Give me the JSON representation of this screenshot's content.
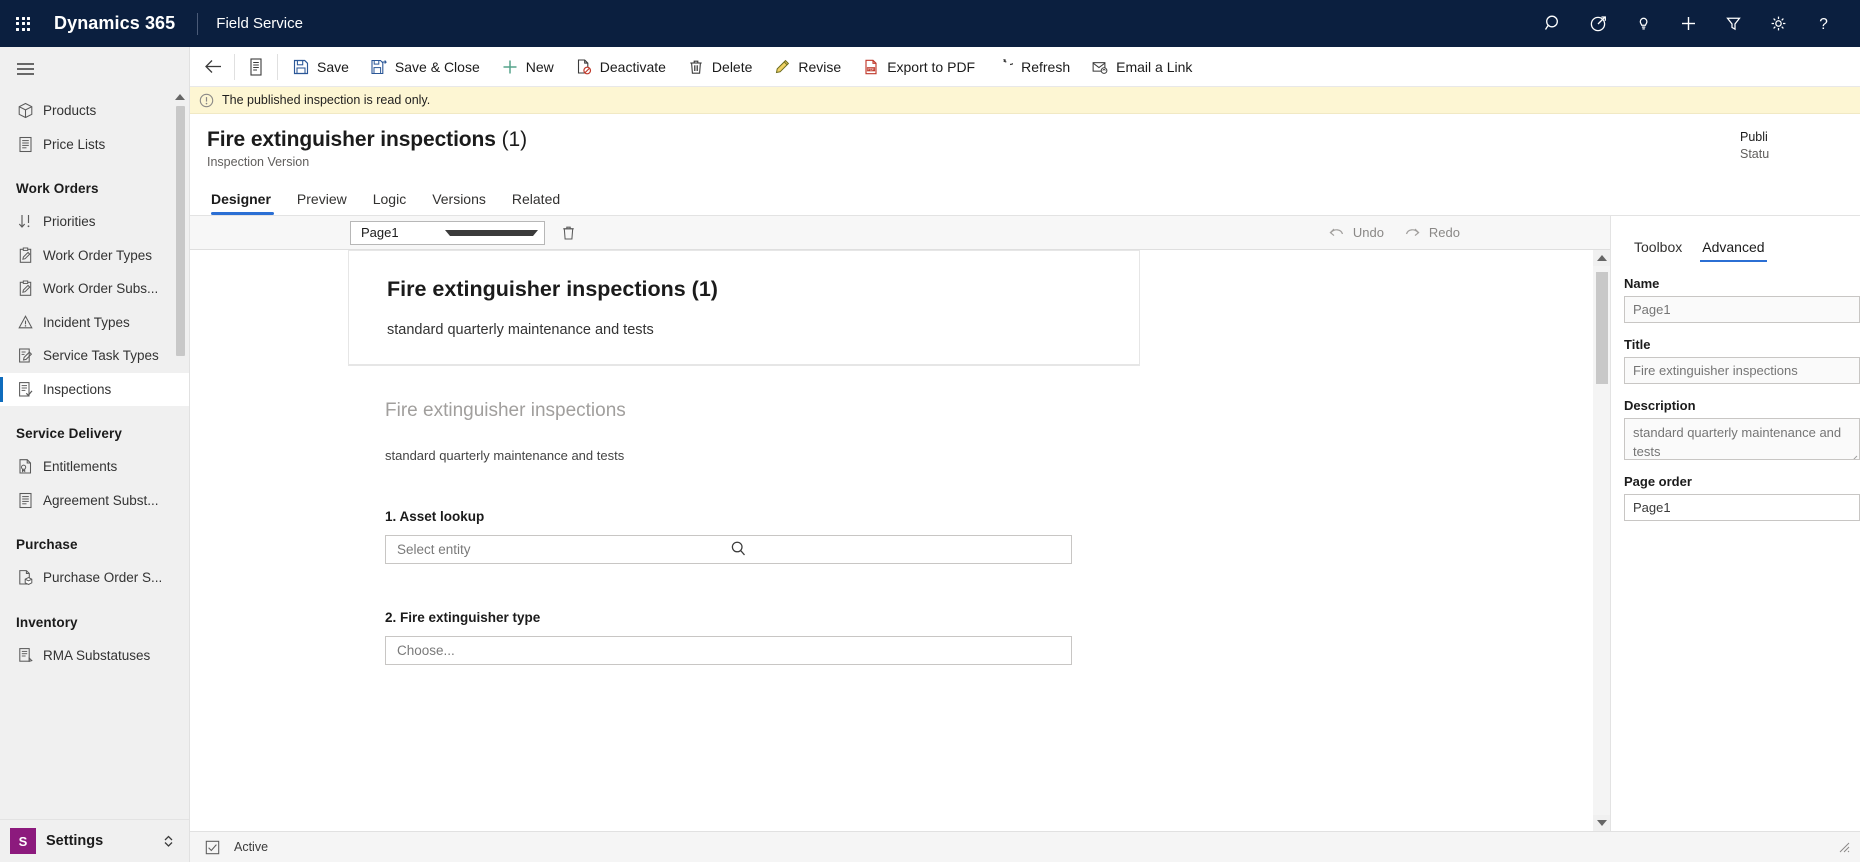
{
  "topnav": {
    "waffle_icon": "app-launcher-icon",
    "brand": "Dynamics 365",
    "app_name": "Field Service",
    "icons": [
      {
        "name": "search-icon",
        "label": "Search"
      },
      {
        "name": "assistant-icon",
        "label": "Assistant"
      },
      {
        "name": "lightbulb-icon",
        "label": "Insights"
      },
      {
        "name": "plus-icon",
        "label": "Quick create"
      },
      {
        "name": "filter-icon",
        "label": "Filter"
      },
      {
        "name": "gear-icon",
        "label": "Settings"
      },
      {
        "name": "help-icon",
        "label": "Help"
      }
    ]
  },
  "sidebar": {
    "hamburger_icon": "hamburger-icon",
    "entries": [
      {
        "type": "item",
        "label": "Products",
        "icon": "box-icon",
        "selected": false
      },
      {
        "type": "item",
        "label": "Price Lists",
        "icon": "list-doc-icon",
        "selected": false
      },
      {
        "type": "group",
        "label": "Work Orders"
      },
      {
        "type": "item",
        "label": "Priorities",
        "icon": "sort-arrows-icon",
        "selected": false
      },
      {
        "type": "item",
        "label": "Work Order Types",
        "icon": "clipboard-pen-icon",
        "selected": false
      },
      {
        "type": "item",
        "label": "Work Order Subs...",
        "icon": "clipboard-pen-icon",
        "selected": false
      },
      {
        "type": "item",
        "label": "Incident Types",
        "icon": "warning-triangle-icon",
        "selected": false
      },
      {
        "type": "item",
        "label": "Service Task Types",
        "icon": "task-pen-icon",
        "selected": false
      },
      {
        "type": "item",
        "label": "Inspections",
        "icon": "checklist-icon",
        "selected": true
      },
      {
        "type": "group",
        "label": "Service Delivery"
      },
      {
        "type": "item",
        "label": "Entitlements",
        "icon": "seal-doc-icon",
        "selected": false
      },
      {
        "type": "item",
        "label": "Agreement Subst...",
        "icon": "list-doc-icon",
        "selected": false
      },
      {
        "type": "group",
        "label": "Purchase"
      },
      {
        "type": "item",
        "label": "Purchase Order S...",
        "icon": "doc-box-icon",
        "selected": false
      },
      {
        "type": "group",
        "label": "Inventory"
      },
      {
        "type": "item",
        "label": "RMA Substatuses",
        "icon": "doc-lines-icon",
        "selected": false
      }
    ],
    "settings": {
      "badge": "S",
      "label": "Settings",
      "chevron_icon": "chevron-updown-icon"
    }
  },
  "commandbar": {
    "back_icon": "back-arrow-icon",
    "form_icon": "form-doc-icon",
    "buttons": [
      {
        "label": "Save",
        "icon": "save-icon"
      },
      {
        "label": "Save & Close",
        "icon": "save-close-icon"
      },
      {
        "label": "New",
        "icon": "plus-icon"
      },
      {
        "label": "Deactivate",
        "icon": "deactivate-icon"
      },
      {
        "label": "Delete",
        "icon": "trash-icon"
      },
      {
        "label": "Revise",
        "icon": "pencil-icon"
      },
      {
        "label": "Export to PDF",
        "icon": "pdf-icon"
      },
      {
        "label": "Refresh",
        "icon": "refresh-icon"
      },
      {
        "label": "Email a Link",
        "icon": "email-link-icon"
      }
    ]
  },
  "notification": {
    "icon": "info-circle-icon",
    "message": "The published inspection is read only."
  },
  "record": {
    "title": "Fire extinguisher inspections",
    "title_number": "(1)",
    "subtitle": "Inspection Version",
    "right_label": "Publi",
    "right_value": "Statu"
  },
  "tabs": [
    {
      "label": "Designer",
      "active": true
    },
    {
      "label": "Preview",
      "active": false
    },
    {
      "label": "Logic",
      "active": false
    },
    {
      "label": "Versions",
      "active": false
    },
    {
      "label": "Related",
      "active": false
    }
  ],
  "designer": {
    "page_selector": {
      "value": "Page1",
      "chevron_icon": "chevron-down-icon"
    },
    "delete_page_icon": "trash-icon",
    "undo": {
      "label": "Undo",
      "icon": "undo-icon"
    },
    "redo": {
      "label": "Redo",
      "icon": "redo-icon"
    },
    "card_header": {
      "title": "Fire extinguisher inspections (1)",
      "description": "standard quarterly maintenance and tests"
    },
    "form": {
      "title": "Fire extinguisher inspections",
      "description": "standard quarterly maintenance and tests",
      "questions": [
        {
          "label": "1. Asset lookup",
          "placeholder": "Select entity",
          "icon": "search-icon",
          "type": "lookup"
        },
        {
          "label": "2. Fire extinguisher type",
          "placeholder": "Choose...",
          "icon": "",
          "type": "choice"
        }
      ]
    }
  },
  "right_panel": {
    "tabs": [
      {
        "label": "Toolbox",
        "active": false
      },
      {
        "label": "Advanced",
        "active": true
      }
    ],
    "fields": [
      {
        "label": "Name",
        "value": "Page1",
        "kind": "input-filled"
      },
      {
        "label": "Title",
        "value": "Fire extinguisher inspections",
        "kind": "input-filled"
      },
      {
        "label": "Description",
        "value": "standard quarterly maintenance and tests",
        "kind": "textarea"
      },
      {
        "label": "Page order",
        "value": "Page1",
        "kind": "input-plain"
      }
    ]
  },
  "statusbar": {
    "save_icon": "save-status-icon",
    "status_text": "Active",
    "resize_icon": "resize-grip-icon"
  },
  "colors": {
    "nav_bg": "#0b1f3f",
    "accent": "#2b6fd4",
    "sidebar_bg": "#f0f0f0",
    "notification_bg": "#fdf6d3",
    "settings_badge": "#8c1a7d",
    "selected_indicator": "#0f6cbd"
  }
}
